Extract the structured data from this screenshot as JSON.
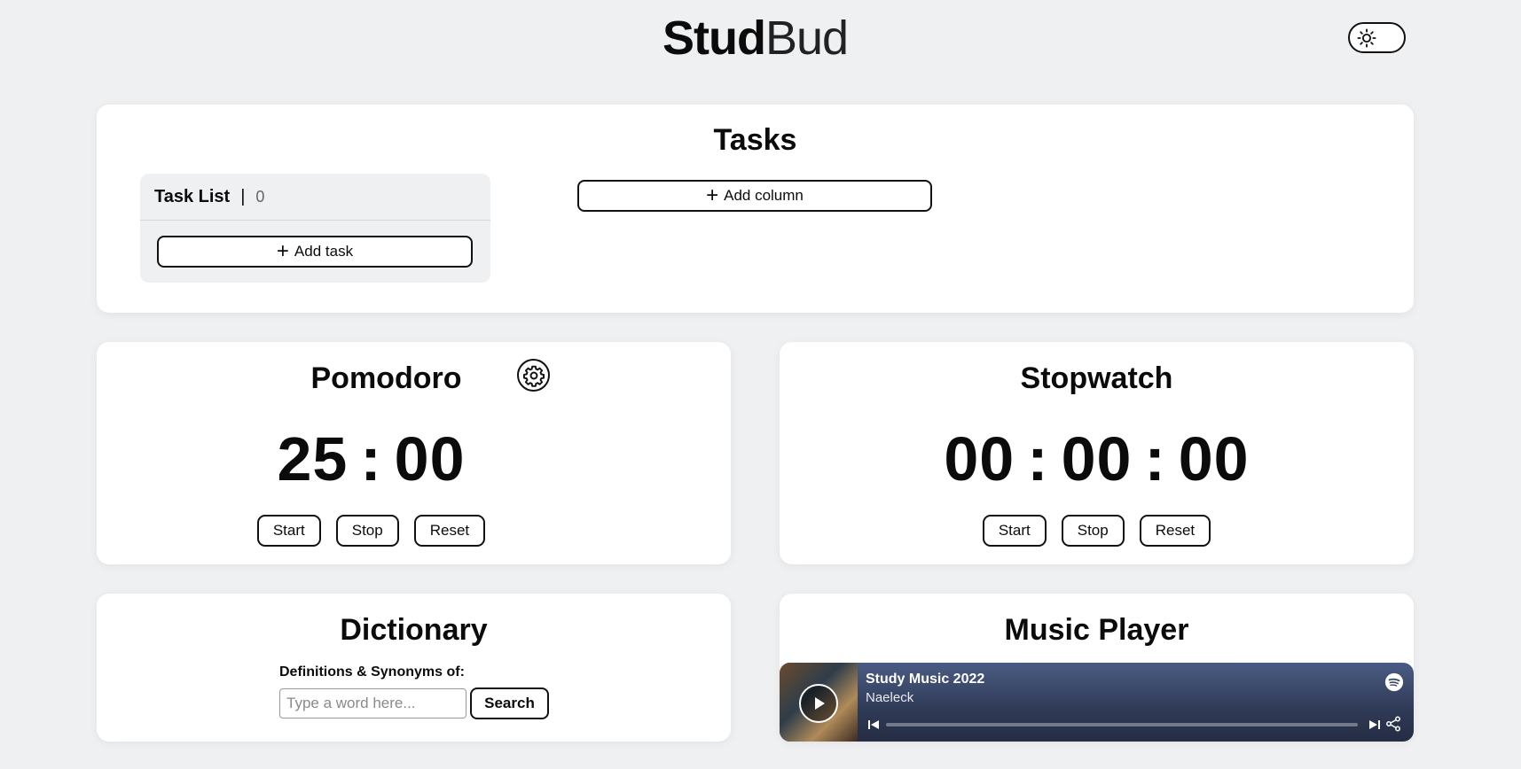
{
  "header": {
    "logo_bold": "Stud",
    "logo_light": "Bud",
    "theme_toggle_icon": "sun-icon"
  },
  "tasks": {
    "title": "Tasks",
    "list": {
      "name": "Task List",
      "separator": "|",
      "count": "0",
      "add_task_label": "Add task"
    },
    "add_column_label": "Add column"
  },
  "pomodoro": {
    "title": "Pomodoro",
    "minutes": "25",
    "seconds": "00",
    "colon": ":",
    "start_label": "Start",
    "stop_label": "Stop",
    "reset_label": "Reset"
  },
  "stopwatch": {
    "title": "Stopwatch",
    "hours": "00",
    "minutes": "00",
    "seconds": "00",
    "colon": ":",
    "start_label": "Start",
    "stop_label": "Stop",
    "reset_label": "Reset"
  },
  "dictionary": {
    "title": "Dictionary",
    "label": "Definitions & Synonyms of:",
    "placeholder": "Type a word here...",
    "value": "",
    "search_label": "Search"
  },
  "music": {
    "title": "Music Player",
    "track_title": "Study Music 2022",
    "artist": "Naeleck",
    "progress_fraction": 0
  },
  "colors": {
    "background": "#eff0f2",
    "card": "#ffffff",
    "embed_gradient_top": "#4a5b83",
    "embed_gradient_bottom": "#252d44"
  }
}
